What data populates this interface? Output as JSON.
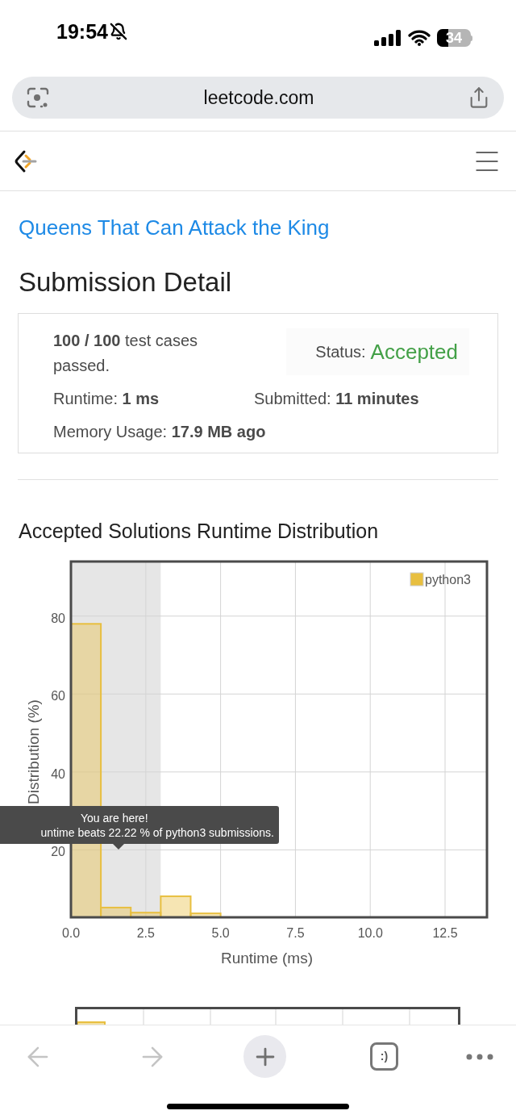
{
  "status_bar": {
    "time": "19:54",
    "battery": "34"
  },
  "browser": {
    "url": "leetcode.com"
  },
  "page": {
    "problem_title": "Queens That Can Attack the King",
    "heading": "Submission Detail",
    "submission": {
      "cases": "**100 / 100** test cases passed.",
      "status_label": "Status:",
      "status": "Accepted",
      "runtime": "Runtime: **1 ms**",
      "submitted": "Submitted: **11 minutes**",
      "memory": "Memory Usage: **17.9 MB ago**"
    },
    "distribution": {
      "title": "Accepted Solutions Runtime Distribution",
      "chart_data": {
        "type": "bar",
        "xlabel": "Runtime (ms)",
        "ylabel": "Distribution (%)",
        "x": [
          0.5,
          1.5,
          2.5,
          3.5,
          4.5
        ],
        "series": [
          {
            "name": "python3",
            "color": "#e8bf40",
            "values": [
              78,
              5.2,
              3.9,
              8.1,
              3.7
            ]
          }
        ],
        "xlim": [
          0,
          13.9
        ],
        "ylim": [
          2.7,
          94
        ],
        "xticks": [
          {
            "value": 0,
            "label": "0.0"
          },
          {
            "value": 2.5,
            "label": "2.5"
          },
          {
            "value": 5,
            "label": "5.0"
          },
          {
            "value": 7.5,
            "label": "7.5"
          },
          {
            "value": 10,
            "label": "10.0"
          },
          {
            "value": 12.5,
            "label": "12.5"
          }
        ],
        "yticks": [
          20,
          40,
          60,
          80
        ],
        "grid": true,
        "bands": [
          {
            "axis": "x",
            "from": 0,
            "to": 3
          }
        ]
      },
      "tooltip": [
        "You are here!",
        "untime beats 22.22 % of python3 submissions."
      ]
    }
  },
  "toolbar": {
    "tabs_label": ":)"
  }
}
